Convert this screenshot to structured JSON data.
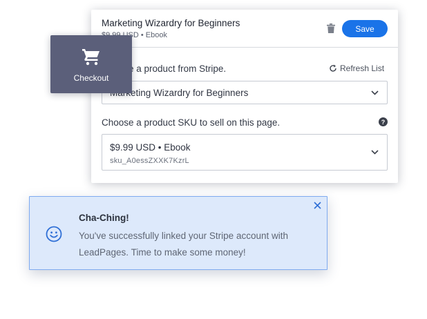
{
  "card": {
    "product_title": "Marketing Wizardry for Beginners",
    "product_subtitle": "$9.99 USD • Ebook",
    "save_label": "Save",
    "product_label": "Choose a product from Stripe.",
    "refresh_label": "Refresh List",
    "product_select_value": "Marketing Wizardry for Beginners",
    "sku_label": "Choose a product SKU to sell on this page.",
    "sku_select_value": "$9.99 USD • Ebook",
    "sku_select_id": "sku_A0essZXXK7KzrL",
    "help_glyph": "?"
  },
  "checkout": {
    "label": "Checkout"
  },
  "notice": {
    "title": "Cha-Ching!",
    "body": "You've successfully linked your Stripe account with LeadPages. Time to make some money!"
  },
  "colors": {
    "accent": "#1a73e8",
    "checkout_tile": "#5b5f7a",
    "notice_bg": "#dde9fb",
    "notice_border": "#7eaaf0"
  },
  "icons": [
    "trash-icon",
    "refresh-icon",
    "help-icon",
    "chevron-down-icon",
    "cart-icon",
    "smile-icon",
    "close-icon"
  ]
}
